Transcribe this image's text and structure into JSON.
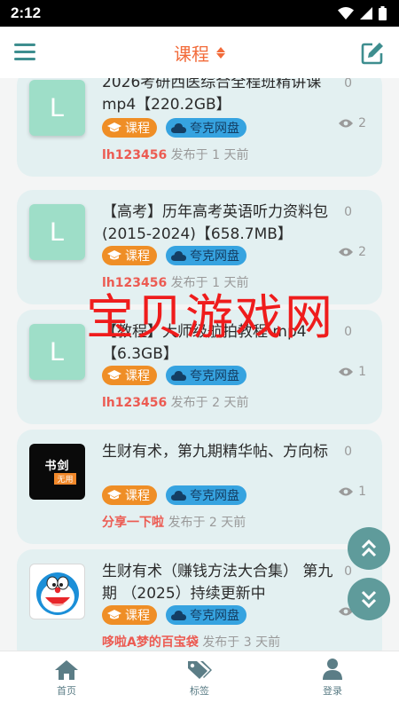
{
  "status": {
    "time": "2:12"
  },
  "appbar": {
    "title": "课程"
  },
  "posts": [
    {
      "thumb": "L",
      "title": "2026考研西医综合全程班精讲课mp4【220.2GB】",
      "tag_category": "课程",
      "tag_disk": "夸克网盘",
      "author": "lh123456",
      "time_text": "发布于 1 天前",
      "likes": "0",
      "views": "2"
    },
    {
      "thumb": "L",
      "title": "【高考】历年高考英语听力资料包 (2015-2024)【658.7MB】",
      "tag_category": "课程",
      "tag_disk": "夸克网盘",
      "author": "lh123456",
      "time_text": "发布于 1 天前",
      "likes": "0",
      "views": "2"
    },
    {
      "thumb": "L",
      "title": "【教程】大师级航拍教程 mp4【6.3GB】",
      "tag_category": "课程",
      "tag_disk": "夸克网盘",
      "author": "lh123456",
      "time_text": "发布于 2 天前",
      "likes": "0",
      "views": "1"
    },
    {
      "thumb_lines": [
        "书剑",
        "无用"
      ],
      "title": "生财有术，第九期精华帖、方向标",
      "tag_category": "课程",
      "tag_disk": "夸克网盘",
      "author": "分享一下啦",
      "time_text": "发布于 2 天前",
      "likes": "0",
      "views": "1"
    },
    {
      "thumb_icon": "doraemon-avatar",
      "title": "生财有术（赚钱方法大合集） 第九期 （2025）持续更新中",
      "tag_category": "课程",
      "tag_disk": "夸克网盘",
      "author": "哆啦A梦的百宝袋",
      "time_text": "发布于 3 天前",
      "likes": "0",
      "views": "1"
    }
  ],
  "watermark": "宝贝游戏网",
  "nav": {
    "home": "首页",
    "tags": "标签",
    "login": "登录"
  },
  "icons": [
    "menu-icon",
    "sort-icon",
    "edit-icon",
    "graduation-cap-icon",
    "cloud-icon",
    "eye-icon",
    "double-chevron-up-icon",
    "double-chevron-down-icon",
    "home-icon",
    "tags-icon",
    "user-icon"
  ],
  "colors": {
    "accent_teal": "#3e8e8f",
    "title_orange": "#f26b3a",
    "card_bg": "#e3f0f1",
    "tag_course": "#ef8e26",
    "tag_quark": "#36a3e0",
    "author_red": "#ec5b52",
    "watermark_red": "#ef1c1c",
    "fab": "#5f9b9b"
  }
}
